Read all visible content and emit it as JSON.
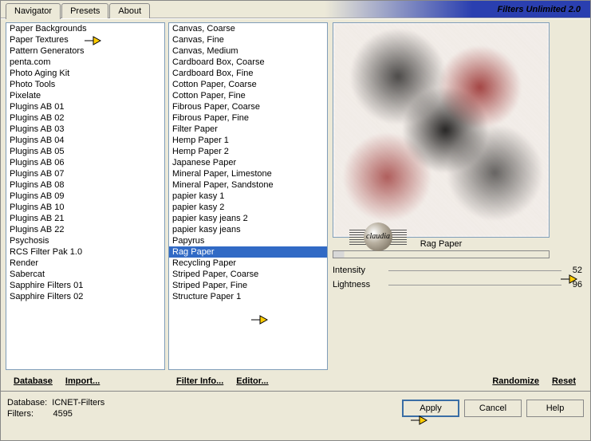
{
  "app_title": "Filters Unlimited 2.0",
  "tabs": {
    "t0": "Navigator",
    "t1": "Presets",
    "t2": "About"
  },
  "categories": [
    "Paper Backgrounds",
    "Paper Textures",
    "Pattern Generators",
    "penta.com",
    "Photo Aging Kit",
    "Photo Tools",
    "Pixelate",
    "Plugins AB 01",
    "Plugins AB 02",
    "Plugins AB 03",
    "Plugins AB 04",
    "Plugins AB 05",
    "Plugins AB 06",
    "Plugins AB 07",
    "Plugins AB 08",
    "Plugins AB 09",
    "Plugins AB 10",
    "Plugins AB 21",
    "Plugins AB 22",
    "Psychosis",
    "RCS Filter Pak 1.0",
    "Render",
    "Sabercat",
    "Sapphire Filters 01",
    "Sapphire Filters 02"
  ],
  "filters": [
    "Canvas, Coarse",
    "Canvas, Fine",
    "Canvas, Medium",
    "Cardboard Box, Coarse",
    "Cardboard Box, Fine",
    "Cotton Paper, Coarse",
    "Cotton Paper, Fine",
    "Fibrous Paper, Coarse",
    "Fibrous Paper, Fine",
    "Filter Paper",
    "Hemp Paper 1",
    "Hemp Paper 2",
    "Japanese Paper",
    "Mineral Paper, Limestone",
    "Mineral Paper, Sandstone",
    "papier kasy 1",
    "papier kasy 2",
    "papier kasy jeans 2",
    "papier kasy jeans",
    "Papyrus",
    "Rag Paper",
    "Recycling Paper",
    "Striped Paper, Coarse",
    "Striped Paper, Fine",
    "Structure Paper 1"
  ],
  "selected_filter": "Rag Paper",
  "buttons": {
    "database": "Database",
    "import": "Import...",
    "filterinfo": "Filter Info...",
    "editor": "Editor...",
    "randomize": "Randomize",
    "reset": "Reset",
    "apply": "Apply",
    "cancel": "Cancel",
    "help": "Help"
  },
  "sliders": {
    "intensity": {
      "label": "Intensity",
      "value": "52"
    },
    "lightness": {
      "label": "Lightness",
      "value": "96"
    }
  },
  "status": {
    "db_label": "Database:",
    "db_value": "ICNET-Filters",
    "filters_label": "Filters:",
    "filters_value": "4595"
  },
  "watermark": "claudia"
}
